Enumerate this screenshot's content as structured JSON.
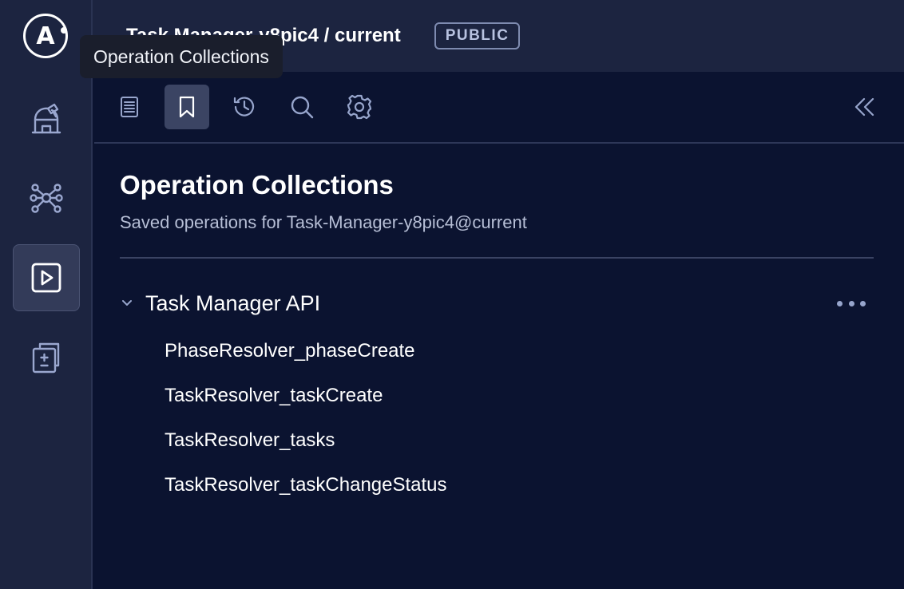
{
  "header": {
    "logo_letter": "A",
    "graph_title": "Task Manager-y8pic4 / current",
    "visibility_badge": "PUBLIC"
  },
  "tooltip": {
    "text": "Operation Collections"
  },
  "left_nav": {
    "items": [
      {
        "icon": "observatory-icon",
        "active": false
      },
      {
        "icon": "graph-nodes-icon",
        "active": false
      },
      {
        "icon": "play-square-icon",
        "active": true
      },
      {
        "icon": "diff-document-icon",
        "active": false
      }
    ]
  },
  "toolbar": {
    "buttons": [
      {
        "icon": "document-icon",
        "active": false
      },
      {
        "icon": "bookmark-icon",
        "active": true
      },
      {
        "icon": "history-icon",
        "active": false
      },
      {
        "icon": "search-icon",
        "active": false
      },
      {
        "icon": "gear-icon",
        "active": false
      }
    ],
    "collapse_icon": "double-chevron-left-icon"
  },
  "main": {
    "title": "Operation Collections",
    "subtitle": "Saved operations for Task-Manager-y8pic4@current",
    "collections": [
      {
        "name": "Task Manager API",
        "expanded": true,
        "operations": [
          "PhaseResolver_phaseCreate",
          "TaskResolver_taskCreate",
          "TaskResolver_tasks",
          "TaskResolver_taskChangeStatus"
        ]
      }
    ]
  },
  "colors": {
    "background": "#0b1330",
    "panel": "#1c2440",
    "active_button": "#3b4463",
    "text": "#ffffff",
    "muted_text": "#b7bfd6",
    "icon": "#97a5cc"
  }
}
